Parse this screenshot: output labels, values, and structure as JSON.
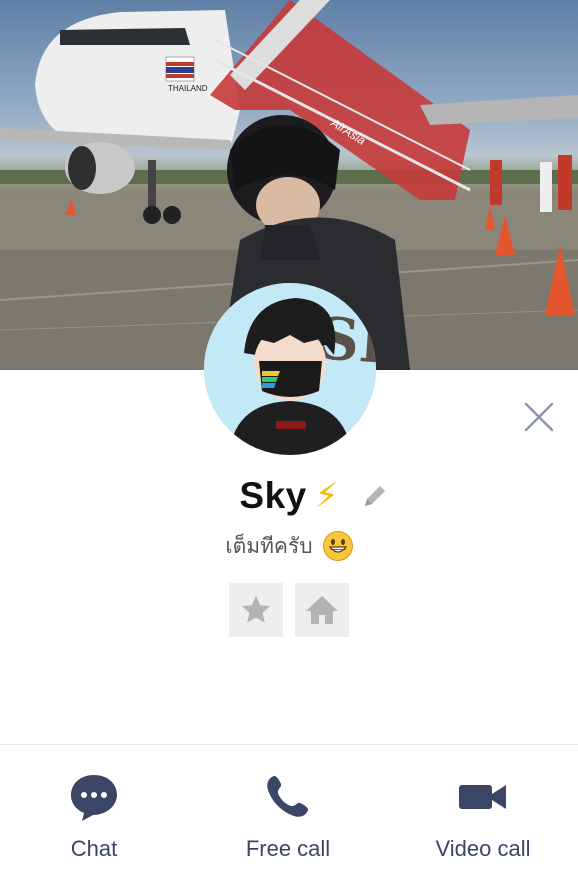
{
  "profile": {
    "name": "Sky",
    "name_emoji": "⚡",
    "status_message": "เต็มทีครับ",
    "status_emoji": "grinning-face-emoji",
    "avatar_text": "SKY"
  },
  "cover": {
    "aircraft_text": "THAILAND",
    "airline_text": "AirAsia"
  },
  "icons": {
    "close": "close-icon",
    "edit": "pencil-icon",
    "favorite": "star-icon",
    "home": "home-icon"
  },
  "bottom_bar": {
    "chat_label": "Chat",
    "free_call_label": "Free call",
    "video_call_label": "Video call"
  },
  "colors": {
    "accent": "#3b4666",
    "action_bg": "#eeeeee",
    "icon_gray": "#b3b3b3",
    "bolt": "#f6b800"
  }
}
